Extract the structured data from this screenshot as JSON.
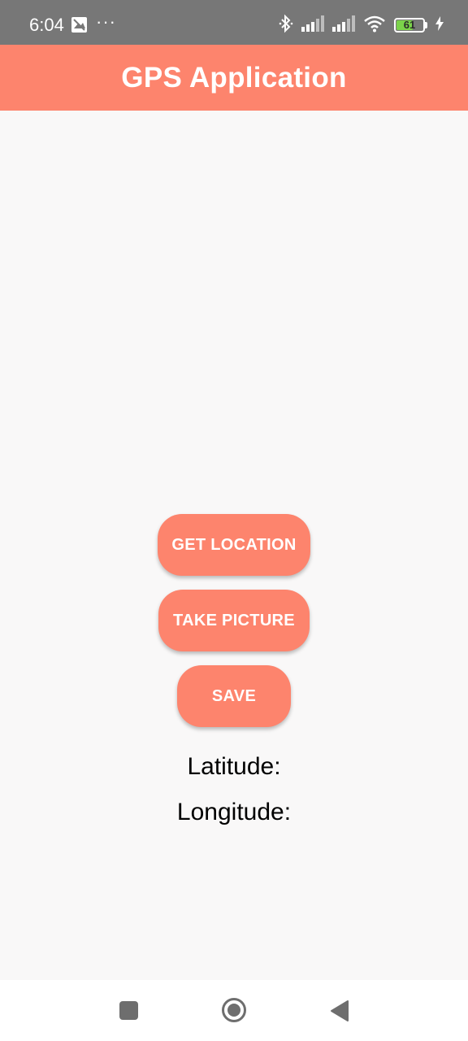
{
  "status_bar": {
    "time": "6:04",
    "overflow_dots": "···",
    "battery_level": "61",
    "battery_fraction": 0.61,
    "icons": [
      "photo-icon",
      "bluetooth-icon",
      "signal-icon",
      "signal-icon",
      "wifi-icon",
      "battery-icon",
      "charging-icon"
    ]
  },
  "app_bar": {
    "title": "GPS Application",
    "color": "#fd846d"
  },
  "actions": {
    "get_location_label": "GET LOCATION",
    "take_picture_label": "TAKE PICTURE",
    "save_label": "SAVE"
  },
  "location": {
    "latitude_label": "Latitude:",
    "longitude_label": "Longitude:"
  },
  "nav_bar": {
    "icons": [
      "recents-icon",
      "home-icon",
      "back-icon"
    ]
  }
}
